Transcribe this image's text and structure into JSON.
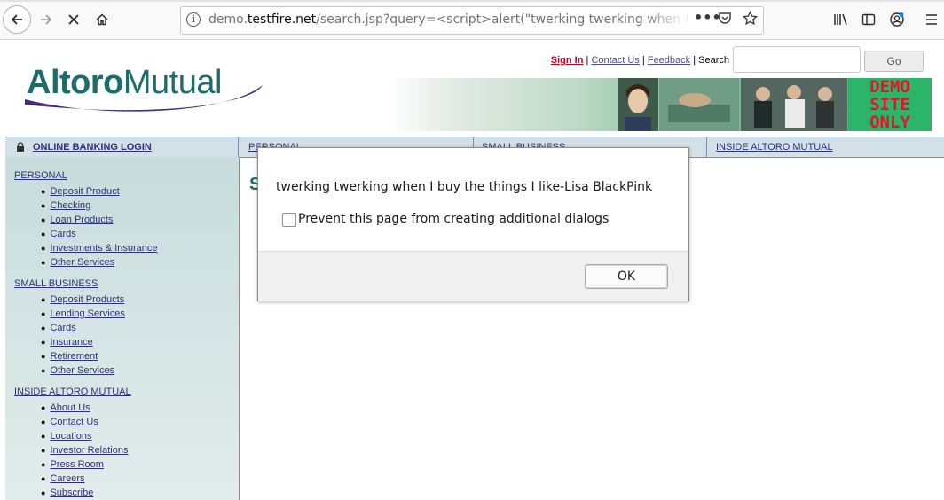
{
  "browser": {
    "url_prefix": "demo.",
    "url_domain": "testfire.net",
    "url_path": "/search.jsp?query=<script>alert(\"twerking twerking when I b",
    "icons": {
      "back": "back-arrow-icon",
      "forward": "forward-arrow-icon",
      "stop": "stop-icon",
      "home": "home-icon",
      "info": "info-icon",
      "more": "more-actions-icon",
      "pocket": "pocket-icon",
      "bookmark": "bookmark-star-icon",
      "library": "library-icon",
      "sidebar": "sidebar-icon",
      "account": "account-icon",
      "menu": "hamburger-menu-icon"
    }
  },
  "header": {
    "logo_bold": "Altoro",
    "logo_light": "Mutual",
    "sign_in": "Sign In",
    "contact": "Contact Us",
    "feedback": "Feedback",
    "search_label": "Search",
    "go_button": "Go",
    "demo_badge": [
      "DEMO",
      "SITE",
      "ONLY"
    ]
  },
  "nav": {
    "login": "ONLINE BANKING LOGIN",
    "personal": "PERSONAL",
    "small_business": "SMALL BUSINESS",
    "inside": "INSIDE ALTORO MUTUAL"
  },
  "sidebar": {
    "personal": {
      "title": "PERSONAL",
      "items": [
        "Deposit Product",
        "Checking",
        "Loan Products",
        "Cards",
        "Investments & Insurance",
        "Other Services"
      ]
    },
    "small_business": {
      "title": "SMALL BUSINESS",
      "items": [
        "Deposit Products",
        "Lending Services",
        "Cards",
        "Insurance",
        "Retirement",
        "Other Services"
      ]
    },
    "inside": {
      "title": "INSIDE ALTORO MUTUAL",
      "items": [
        "About Us",
        "Contact Us",
        "Locations",
        "Investor Relations",
        "Press Room",
        "Careers",
        "Subscribe"
      ]
    }
  },
  "main": {
    "heading_peek": "S"
  },
  "dialog": {
    "message": "twerking twerking when I buy the things I like-Lisa BlackPink",
    "checkbox_label": "Prevent this page from creating additional dialogs",
    "ok_label": "OK"
  },
  "colors": {
    "brand_teal": "#1d6c6c",
    "nav_bg": "#d3e0e6",
    "link": "#303078",
    "sign_in_red": "#c8001f",
    "demo_green": "#2bb56a"
  }
}
